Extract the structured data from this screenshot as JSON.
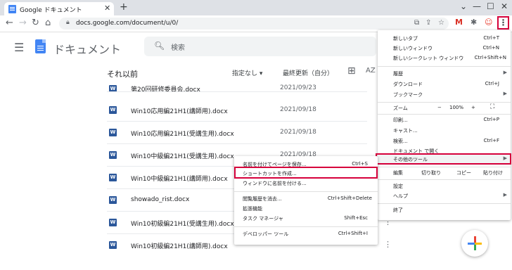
{
  "browser": {
    "tab_title": "Google ドキュメント",
    "url": "docs.google.com/document/u/0/"
  },
  "app": {
    "title": "ドキュメント",
    "search_placeholder": "検索"
  },
  "list": {
    "section_title": "それ以前",
    "owner_filter": "指定なし ▾",
    "sort_label": "最終更新（自分）",
    "files": [
      {
        "name": "第20回研修委員会.docx",
        "date": "2021/09/23"
      },
      {
        "name": "Win10応用編21H1(講師用).docx",
        "date": "2021/09/18"
      },
      {
        "name": "Win10応用編21H1(受講生用).docx",
        "date": "2021/09/18"
      },
      {
        "name": "Win10中級編21H1(受講生用).docx",
        "date": "2021/09/18"
      },
      {
        "name": "Win10中級編21H1(講師用).docx",
        "date": ""
      },
      {
        "name": "showado_rist.docx",
        "date": ""
      },
      {
        "name": "Win10初級編21H1(受講生用).docx",
        "date": ""
      },
      {
        "name": "Win10初級編21H1(講師用).docx",
        "date": ""
      }
    ]
  },
  "chrome_menu": {
    "new_tab": "新しいタブ",
    "new_tab_sc": "Ctrl+T",
    "new_window": "新しいウィンドウ",
    "new_window_sc": "Ctrl+N",
    "incognito": "新しいシークレット ウィンドウ",
    "incognito_sc": "Ctrl+Shift+N",
    "history": "履歴",
    "downloads": "ダウンロード",
    "downloads_sc": "Ctrl+J",
    "bookmarks": "ブックマーク",
    "zoom": "ズーム",
    "zoom_minus": "−",
    "zoom_value": "100%",
    "zoom_plus": "+",
    "print": "印刷...",
    "print_sc": "Ctrl+P",
    "cast": "キャスト...",
    "find": "検索...",
    "find_sc": "Ctrl+F",
    "open_in_docs": "ドキュメント で開く",
    "more_tools": "その他のツール",
    "edit": "編集",
    "cut": "切り取り",
    "copy": "コピー",
    "paste": "貼り付け",
    "settings": "設定",
    "help": "ヘルプ",
    "exit": "終了"
  },
  "submenu": {
    "save_page": "名前を付けてページを保存...",
    "save_page_sc": "Ctrl+S",
    "create_shortcut": "ショートカットを作成...",
    "name_window": "ウィンドウに名前を付ける...",
    "clear_data": "閲覧履歴を消去...",
    "clear_data_sc": "Ctrl+Shift+Delete",
    "extensions": "拡張機能",
    "task_manager": "タスク マネージャ",
    "task_manager_sc": "Shift+Esc",
    "devtools": "デベロッパー ツール",
    "devtools_sc": "Ctrl+Shift+I"
  },
  "colors": {
    "highlight": "#d6003b",
    "docs_blue": "#4285f4",
    "word_blue": "#2b579a"
  }
}
